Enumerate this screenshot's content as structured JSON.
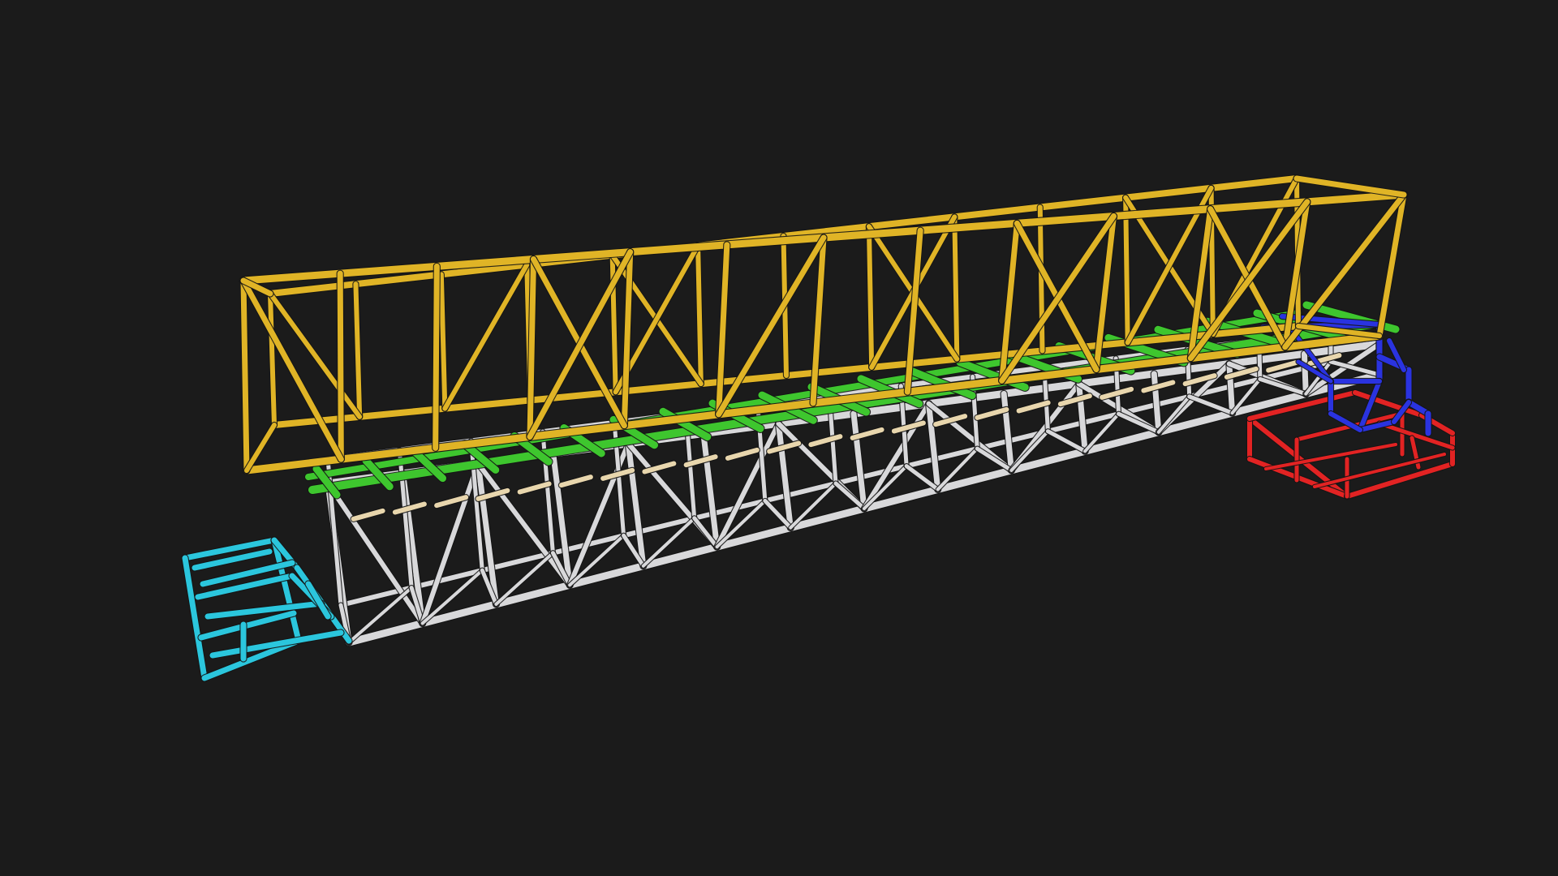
{
  "viewport": {
    "background_color": "#1b1b1b"
  },
  "model": {
    "type": "3d-truss-bridge-wireframe",
    "components": [
      {
        "name": "truss",
        "color": "#e0b426"
      },
      {
        "name": "deck-stringers",
        "color": "#3ec62e"
      },
      {
        "name": "deck-support-frame",
        "color": "#d8d8da"
      },
      {
        "name": "deck-cross-boards",
        "color": "#e8d6ad"
      },
      {
        "name": "left-stairs",
        "color": "#2bc6dd"
      },
      {
        "name": "right-upper-stairs",
        "color": "#2a33e0"
      },
      {
        "name": "right-lower-stairs",
        "color": "#e22323"
      }
    ]
  }
}
